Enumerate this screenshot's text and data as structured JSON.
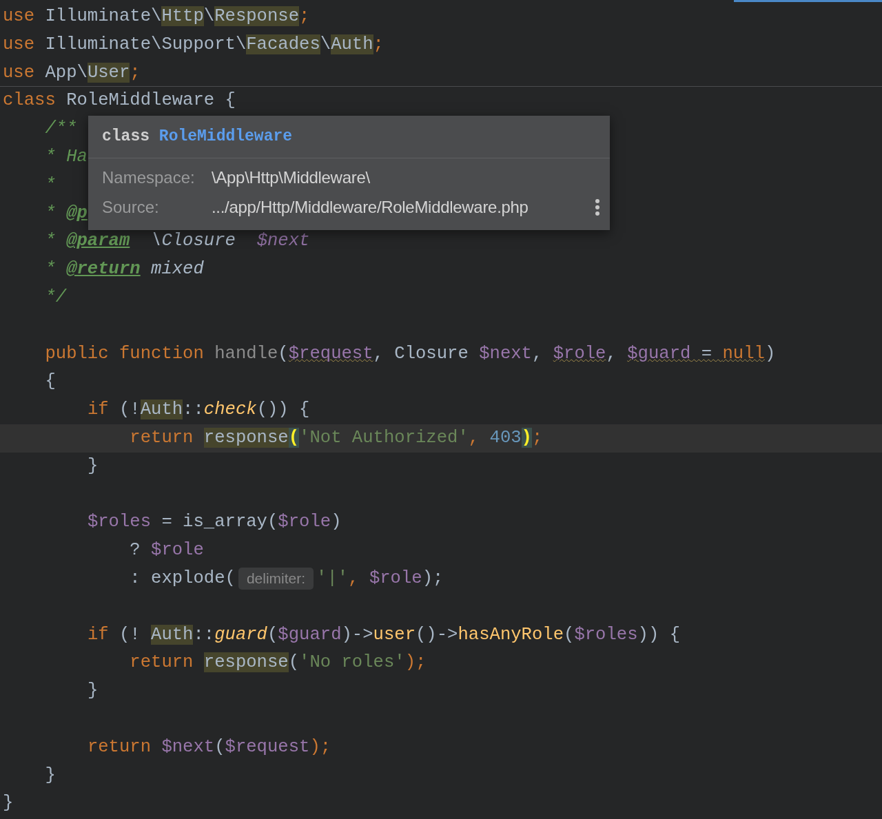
{
  "editor": {
    "lines": [
      {
        "current": false,
        "tokens": [
          {
            "text": "use",
            "kind": "keyword"
          },
          {
            "text": " Illuminate\\",
            "kind": "plain"
          },
          {
            "text": "Http",
            "kind": "ref"
          },
          {
            "text": "\\",
            "kind": "plain"
          },
          {
            "text": "Response",
            "kind": "ref"
          },
          {
            "text": ";",
            "kind": "keyword"
          }
        ]
      },
      {
        "current": false,
        "tokens": [
          {
            "text": "use",
            "kind": "keyword"
          },
          {
            "text": " Illuminate\\Support\\",
            "kind": "plain"
          },
          {
            "text": "Facades",
            "kind": "ref"
          },
          {
            "text": "\\",
            "kind": "plain"
          },
          {
            "text": "Auth",
            "kind": "ref"
          },
          {
            "text": ";",
            "kind": "keyword"
          }
        ]
      },
      {
        "current": false,
        "tokens": [
          {
            "text": "use",
            "kind": "keyword"
          },
          {
            "text": " App\\",
            "kind": "plain"
          },
          {
            "text": "User",
            "kind": "ref"
          },
          {
            "text": ";",
            "kind": "keyword"
          }
        ]
      },
      {
        "current": false,
        "tokens": [
          {
            "text": "class",
            "kind": "keyword"
          },
          {
            "text": " RoleMiddleware {",
            "kind": "plain"
          }
        ],
        "children": [
          {
            "current": false,
            "tokens": [
              {
                "text": "/**",
                "kind": "doc"
              }
            ]
          },
          {
            "current": false,
            "tokens": [
              {
                "text": "* Ha",
                "kind": "doc"
              }
            ]
          },
          {
            "current": false,
            "tokens": [
              {
                "text": "*",
                "kind": "doc"
              }
            ]
          },
          {
            "current": false,
            "tokens": [
              {
                "text": "* ",
                "kind": "doc"
              },
              {
                "text": "@p",
                "kind": "doctag"
              }
            ]
          },
          {
            "current": false,
            "tokens": [
              {
                "text": "* ",
                "kind": "doc"
              },
              {
                "text": "@param",
                "kind": "doctag"
              },
              {
                "text": "  \\Closure  ",
                "kind": "doctype"
              },
              {
                "text": "$next",
                "kind": "docvar"
              }
            ]
          },
          {
            "current": false,
            "tokens": [
              {
                "text": "* ",
                "kind": "doc"
              },
              {
                "text": "@return",
                "kind": "doctag"
              },
              {
                "text": " mixed",
                "kind": "doctype"
              }
            ]
          },
          {
            "current": false,
            "tokens": [
              {
                "text": "*/",
                "kind": "doc"
              }
            ]
          },
          {
            "current": false
          },
          {
            "current": false,
            "tokens": [
              {
                "text": "public function",
                "kind": "keyword"
              },
              {
                "text": " handle",
                "kind": "dim"
              },
              {
                "text": "(",
                "kind": "plain"
              },
              {
                "text": "$request",
                "kind": "var_warn"
              },
              {
                "text": ", Closure ",
                "kind": "plain"
              },
              {
                "text": "$next",
                "kind": "var"
              },
              {
                "text": ", ",
                "kind": "plain"
              },
              {
                "text": "$role",
                "kind": "var_warn"
              },
              {
                "text": ", ",
                "kind": "plain"
              },
              {
                "text": "$guard",
                "kind": "var_warn"
              },
              {
                "text": " = ",
                "kind": "plain_warn"
              },
              {
                "text": "null",
                "kind": "keyword_warn"
              },
              {
                "text": ")",
                "kind": "plain"
              }
            ]
          },
          {
            "current": false,
            "tokens": [
              {
                "text": "{",
                "kind": "plain"
              }
            ],
            "children": [
              {
                "current": false,
                "tokens": [
                  {
                    "text": "if",
                    "kind": "keyword"
                  },
                  {
                    "text": " (!",
                    "kind": "plain"
                  },
                  {
                    "text": "Auth",
                    "kind": "ref"
                  },
                  {
                    "text": "::",
                    "kind": "plain"
                  },
                  {
                    "text": "check",
                    "kind": "static"
                  },
                  {
                    "text": "()) {",
                    "kind": "plain"
                  }
                ],
                "children": [
                  {
                    "current": true,
                    "tokens": [
                      {
                        "text": "return ",
                        "kind": "keyword"
                      },
                      {
                        "text": "response",
                        "kind": "ref"
                      },
                      {
                        "text": "(",
                        "kind": "match"
                      },
                      {
                        "text": "'Not Authorized'",
                        "kind": "string"
                      },
                      {
                        "text": ", ",
                        "kind": "keyword"
                      },
                      {
                        "text": "403",
                        "kind": "number"
                      },
                      {
                        "text": ")",
                        "kind": "match"
                      },
                      {
                        "text": ";",
                        "kind": "keyword"
                      }
                    ]
                  }
                ]
              },
              {
                "current": false,
                "tokens": [
                  {
                    "text": "}",
                    "kind": "plain"
                  }
                ]
              },
              {
                "current": false
              },
              {
                "current": false,
                "tokens": [
                  {
                    "text": "$roles",
                    "kind": "var"
                  },
                  {
                    "text": " = is_array(",
                    "kind": "plain"
                  },
                  {
                    "text": "$role",
                    "kind": "var"
                  },
                  {
                    "text": ")",
                    "kind": "plain"
                  }
                ],
                "children": [
                  {
                    "current": false,
                    "tokens": [
                      {
                        "text": "? ",
                        "kind": "plain"
                      },
                      {
                        "text": "$role",
                        "kind": "var"
                      }
                    ]
                  },
                  {
                    "current": false,
                    "tokens": [
                      {
                        "text": ": explode(",
                        "kind": "plain"
                      },
                      {
                        "text": "delimiter:",
                        "kind": "hint"
                      },
                      {
                        "text": "'|'",
                        "kind": "string"
                      },
                      {
                        "text": ", ",
                        "kind": "keyword"
                      },
                      {
                        "text": "$role",
                        "kind": "var"
                      },
                      {
                        "text": ");",
                        "kind": "plain"
                      }
                    ]
                  }
                ]
              },
              {
                "current": false
              },
              {
                "current": false,
                "tokens": [
                  {
                    "text": "if",
                    "kind": "keyword"
                  },
                  {
                    "text": " (! ",
                    "kind": "plain"
                  },
                  {
                    "text": "Auth",
                    "kind": "ref"
                  },
                  {
                    "text": "::",
                    "kind": "plain"
                  },
                  {
                    "text": "guard",
                    "kind": "static"
                  },
                  {
                    "text": "(",
                    "kind": "plain"
                  },
                  {
                    "text": "$guard",
                    "kind": "var"
                  },
                  {
                    "text": ")->",
                    "kind": "plain"
                  },
                  {
                    "text": "user",
                    "kind": "method"
                  },
                  {
                    "text": "()->",
                    "kind": "plain"
                  },
                  {
                    "text": "hasAnyRole",
                    "kind": "method"
                  },
                  {
                    "text": "(",
                    "kind": "plain"
                  },
                  {
                    "text": "$roles",
                    "kind": "var"
                  },
                  {
                    "text": ")) {",
                    "kind": "plain"
                  }
                ],
                "children": [
                  {
                    "current": false,
                    "tokens": [
                      {
                        "text": "return ",
                        "kind": "keyword"
                      },
                      {
                        "text": "response",
                        "kind": "ref"
                      },
                      {
                        "text": "(",
                        "kind": "plain"
                      },
                      {
                        "text": "'No roles'",
                        "kind": "string"
                      },
                      {
                        "text": ");",
                        "kind": "keyword"
                      }
                    ]
                  }
                ]
              },
              {
                "current": false,
                "tokens": [
                  {
                    "text": "}",
                    "kind": "plain"
                  }
                ]
              },
              {
                "current": false
              },
              {
                "current": false,
                "tokens": [
                  {
                    "text": "return ",
                    "kind": "keyword"
                  },
                  {
                    "text": "$next",
                    "kind": "var"
                  },
                  {
                    "text": "(",
                    "kind": "plain"
                  },
                  {
                    "text": "$request",
                    "kind": "var"
                  },
                  {
                    "text": ");",
                    "kind": "keyword"
                  }
                ]
              }
            ]
          },
          {
            "current": false,
            "tokens": [
              {
                "text": "}",
                "kind": "plain"
              }
            ]
          }
        ]
      },
      {
        "current": false,
        "tokens": [
          {
            "text": "}",
            "kind": "plain"
          }
        ]
      }
    ]
  },
  "tooltip": {
    "keyword": "class",
    "name": "RoleMiddleware",
    "rows": [
      {
        "label": "Namespace:",
        "value": "\\App\\Http\\Middleware\\"
      },
      {
        "label": "Source:",
        "value": ".../app/Http/Middleware/RoleMiddleware.php"
      }
    ]
  }
}
